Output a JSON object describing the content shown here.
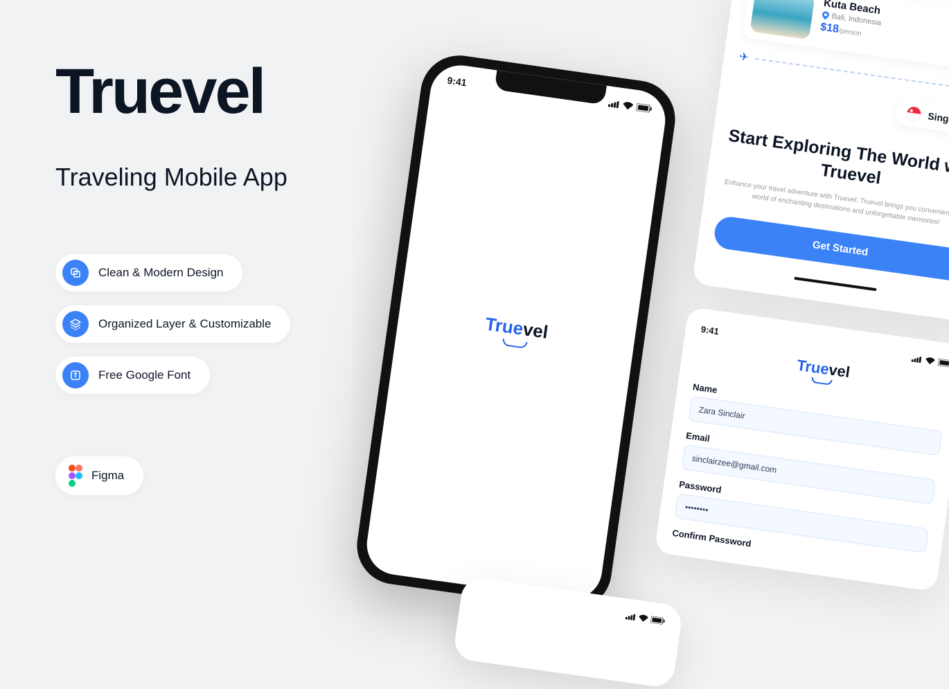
{
  "hero": {
    "title": "Truevel",
    "subtitle": "Traveling Mobile App"
  },
  "features": [
    "Clean & Modern Design",
    "Organized Layer & Customizable",
    "Free Google Font"
  ],
  "figma_label": "Figma",
  "phone": {
    "time": "9:41",
    "logo_part1": "True",
    "logo_part2": "vel"
  },
  "onboard": {
    "dest_name": "Kuta Beach",
    "dest_location": "Bali, Indonesia",
    "dest_price": "$18",
    "dest_price_unit": "/person",
    "country": "Singapore",
    "headline": "Start Exploring The World with Truevel",
    "sub": "Enhance your travel adventure with Truevel. Truevel brings you convenience to a world of enchanting destinations and unforgettable memories!",
    "cta": "Get Started"
  },
  "signup": {
    "time": "9:41",
    "logo_part1": "True",
    "logo_part2": "vel",
    "fields": {
      "name_label": "Name",
      "name_value": "Zara Sinclair",
      "email_label": "Email",
      "email_value": "sinclairzee@gmail.com",
      "password_label": "Password",
      "password_value": "••••••••",
      "confirm_label": "Confirm Password"
    }
  }
}
